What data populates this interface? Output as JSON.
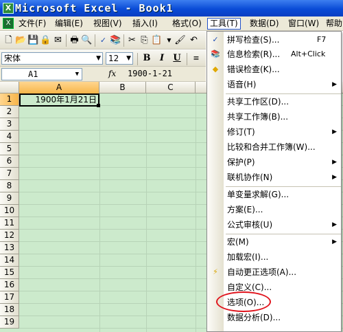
{
  "window": {
    "title": "Microsoft Excel - Book1"
  },
  "menubar": {
    "items": [
      {
        "label": "文件(F)",
        "key": "file"
      },
      {
        "label": "编辑(E)",
        "key": "edit"
      },
      {
        "label": "视图(V)",
        "key": "view"
      },
      {
        "label": "插入(I)",
        "key": "insert"
      },
      {
        "label": "格式(O)",
        "key": "format"
      },
      {
        "label": "工具(T)",
        "key": "tools",
        "active": true
      },
      {
        "label": "数据(D)",
        "key": "data"
      },
      {
        "label": "窗口(W)",
        "key": "window"
      },
      {
        "label": "帮助",
        "key": "help"
      }
    ]
  },
  "formatting": {
    "font_name": "宋体",
    "font_size": "12",
    "bold": "B",
    "italic": "I",
    "underline": "U"
  },
  "formula_bar": {
    "cell_ref": "A1",
    "fx_symbol": "fx",
    "value": "1900-1-21"
  },
  "sheet": {
    "columns": [
      "A",
      "B",
      "C"
    ],
    "rows": [
      "1",
      "2",
      "3",
      "4",
      "5",
      "6",
      "7",
      "8",
      "9",
      "10",
      "11",
      "12",
      "13",
      "14",
      "15",
      "16",
      "17",
      "18",
      "19"
    ],
    "cell_a1": "1900年1月21日"
  },
  "tools_menu": {
    "items": [
      {
        "label": "拼写检查(S)...",
        "shortcut": "F7",
        "icon": "spellcheck-icon"
      },
      {
        "label": "信息检索(R)...",
        "shortcut": "Alt+Click",
        "icon": "research-icon"
      },
      {
        "label": "错误检查(K)...",
        "icon": "error-check-icon"
      },
      {
        "label": "语音(H)",
        "submenu": true
      },
      {
        "label": "共享工作区(D)..."
      },
      {
        "label": "共享工作簿(B)..."
      },
      {
        "label": "修订(T)",
        "submenu": true
      },
      {
        "label": "比较和合并工作簿(W)..."
      },
      {
        "label": "保护(P)",
        "submenu": true
      },
      {
        "label": "联机协作(N)",
        "submenu": true
      },
      {
        "label": "单变量求解(G)..."
      },
      {
        "label": "方案(E)..."
      },
      {
        "label": "公式审核(U)",
        "submenu": true
      },
      {
        "label": "宏(M)",
        "submenu": true
      },
      {
        "label": "加载宏(I)..."
      },
      {
        "label": "自动更正选项(A)...",
        "icon": "autocorrect-icon"
      },
      {
        "label": "自定义(C)..."
      },
      {
        "label": "选项(O)..."
      },
      {
        "label": "数据分析(D)..."
      }
    ],
    "submenu_arrow": "▶"
  },
  "colors": {
    "title_bar": "#0a4bd6",
    "grid_background": "#cceacc",
    "menu_background": "#ece9d8",
    "highlight_circle": "#e0141d"
  }
}
